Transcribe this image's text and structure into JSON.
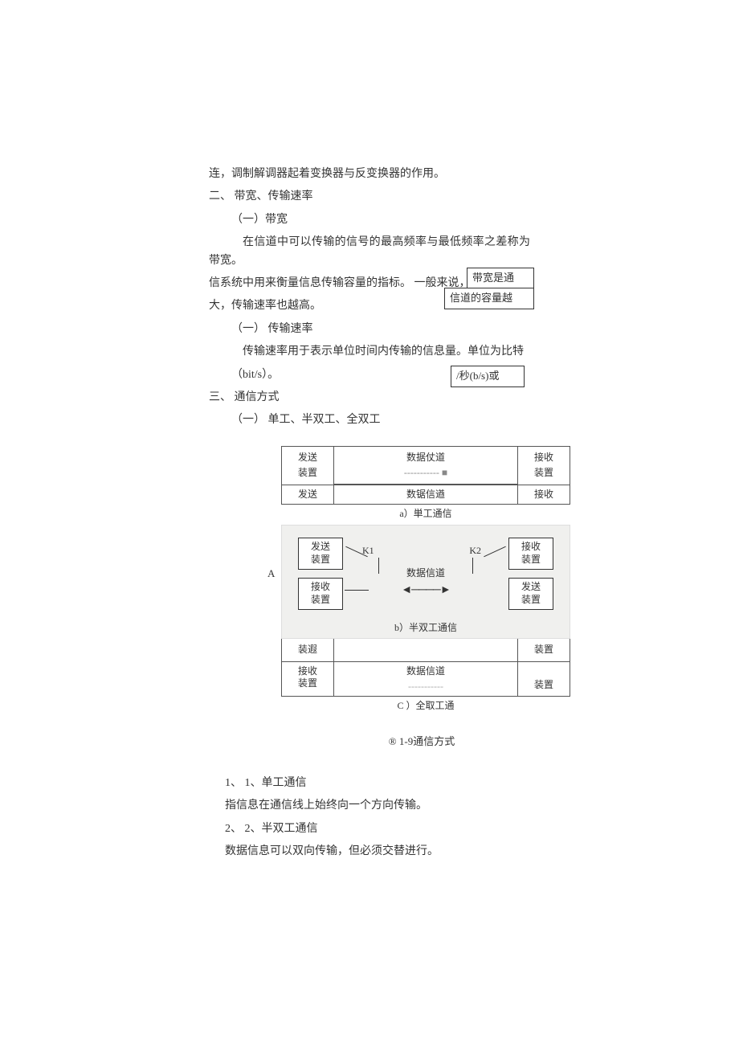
{
  "paragraphs": {
    "p1": "连，调制解调器起着变换器与反变换器的作用。",
    "h2": "二、 带宽、传输速率",
    "h2a": "（一）带宽",
    "p2": "在信道中可以传输的信号的最高频率与最低频率之差称为带宽。",
    "p3": "信系统中用来衡量信息传输容量的指标。 一般来说，带宽越大，",
    "p4": "大，传输速率也越高。",
    "h2b": "（一） 传输速率",
    "p5": "传输速率用于表示单位时间内传输的信息量。单位为比特",
    "p6": "（bit/s）。",
    "h3": "三、 通信方式",
    "h3a": "（一） 单工、半双工、全双工"
  },
  "notes": {
    "n1": "带宽是通",
    "n2": "信道的容量越",
    "n3": "/秒(b/s)或"
  },
  "diagram": {
    "a": {
      "left1": "发送",
      "left2": "装置",
      "mid1": "数据仗道",
      "right1": "接收",
      "right2": "装置",
      "left3": "发送",
      "mid2": "数锯信遒",
      "right3": "接收",
      "caption": "a）単工通信"
    },
    "b": {
      "a_label": "A",
      "tl": "发送\n装置",
      "bl": "接收\n装置",
      "tr": "接收\n装置",
      "br": "发送\n装置",
      "k1": "K1",
      "k2": "K2",
      "channel": "数据信道",
      "arrow": "◄────►",
      "caption": "b）半双工通信"
    },
    "c": {
      "left1": "装遐",
      "right1": "装置",
      "left2": "接收\n装置",
      "mid2": "数据信道",
      "right2": "装置",
      "caption": "C ）全取工通"
    }
  },
  "fig_caption": "® 1-9通信方式",
  "items": {
    "i1_num": "1、 1、单工通信",
    "i1_text": "指信息在通信线上始终向一个方向传输。",
    "i2_num": "2、 2、半双工通信",
    "i2_text": "数据信息可以双向传输，但必须交替进行。"
  }
}
